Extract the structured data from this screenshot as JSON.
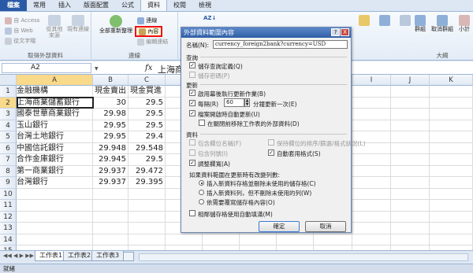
{
  "tabs": [
    "檔案",
    "常用",
    "插入",
    "版面配置",
    "公式",
    "資料",
    "校閱",
    "檢視"
  ],
  "active_tab": "資料",
  "ribbon": {
    "external": {
      "label": "取得外部資料",
      "from_access": "自 Access",
      "from_web": "自 Web",
      "from_text": "從文字檔",
      "from_other": "從其他",
      "from_other2": "來源",
      "existing": "現有連線"
    },
    "connections": {
      "label": "連線",
      "refresh_all": "全部重新整理",
      "connections": "連線",
      "properties": "內容",
      "edit_links": "編輯連結"
    },
    "outline": {
      "label": "大綱",
      "group": "群組",
      "ungroup": "取消群組",
      "subtotal": "小計"
    }
  },
  "formula_bar": {
    "name": "A2",
    "fx": "fx",
    "value": "上海商"
  },
  "columns": [
    "A",
    "B",
    "C",
    "D",
    "E",
    "F",
    "G",
    "H",
    "I",
    "J",
    "K"
  ],
  "rows": [
    [
      "金融機構",
      "現金賣出",
      "現金買進"
    ],
    [
      "上海商業儲蓄銀行",
      "30",
      "29.5"
    ],
    [
      "國泰世華商業銀行",
      "29.98",
      "29.5"
    ],
    [
      "玉山銀行",
      "29.95",
      "29.5"
    ],
    [
      "台灣土地銀行",
      "29.95",
      "29.4"
    ],
    [
      "中國信託銀行",
      "29.948",
      "29.548"
    ],
    [
      "合作金庫銀行",
      "29.945",
      "29.5"
    ],
    [
      "第一商業銀行",
      "29.937",
      "29.472"
    ],
    [
      "台灣銀行",
      "29.937",
      "29.395"
    ]
  ],
  "sheets": [
    "工作表1",
    "工作表2",
    "工作表3"
  ],
  "status": "就緒",
  "dialog": {
    "title": "外部資料範圍內容",
    "help": "?",
    "close": "X",
    "name_label": "名稱(N):",
    "name_value": "currency_foreign2bank?currency=USD",
    "query_label": "查詢",
    "save_query": "儲存查詢定義(Q)",
    "save_password": "儲存密碼(P)",
    "refresh_label": "更新",
    "bg_refresh": "啟用幕後執行更新作業(B)",
    "every": "每隔(R)",
    "minutes": "60",
    "minutes_suffix": "分鐘更新一次(E)",
    "refresh_open": "檔案開啟時自動更新(U)",
    "remove_data": "在關閉前移除工作表的外部資料(D)",
    "data_format_label": "資料",
    "include_field": "包含欄位名稱(F)",
    "preserve_sort": "保持欄位的排序/篩選/格式狀況(L)",
    "include_row": "包含列號(I)",
    "auto_width": "自動套用格式(S)",
    "adjust_width": "調整欄寬(A)",
    "change_rows": "如果資料範圍在更新時有改變列數:",
    "opt1": "插入新資料存格並刪除未使用的儲存格(C)",
    "opt2": "插入新資料列，但不刪除未使用的列(W)",
    "opt3": "依需要覆寫儲存格內容(O)",
    "fill_down": "相鄰儲存格使用自動填滿(M)",
    "ok": "確定",
    "cancel": "取消"
  }
}
